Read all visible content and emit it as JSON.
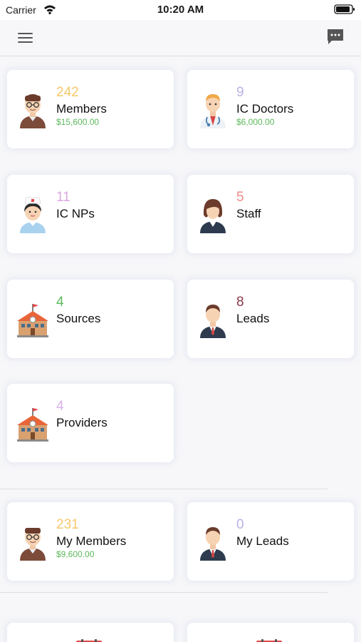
{
  "status_bar": {
    "carrier": "Carrier",
    "time": "10:20 AM"
  },
  "nav": {
    "menu_icon": "hamburger-menu-icon",
    "chat_icon": "chat-bubble-icon"
  },
  "cards": [
    {
      "icon": "doctor-male-icon",
      "count": "242",
      "title": "Members",
      "amount": "$15,600.00",
      "count_color": "#f5c96a"
    },
    {
      "icon": "doctor-stethoscope-icon",
      "count": "9",
      "title": "IC Doctors",
      "amount": "$6,000.00",
      "count_color": "#b9b2e6"
    },
    {
      "icon": "nurse-icon",
      "count": "11",
      "title": "IC NPs",
      "amount": "",
      "count_color": "#d9a8e0"
    },
    {
      "icon": "staff-woman-icon",
      "count": "5",
      "title": "Staff",
      "amount": "",
      "count_color": "#f08a8a"
    },
    {
      "icon": "school-building-icon",
      "count": "4",
      "title": "Sources",
      "amount": "",
      "count_color": "#5cb85c"
    },
    {
      "icon": "businessman-icon",
      "count": "8",
      "title": "Leads",
      "amount": "",
      "count_color": "#8b3a4a"
    },
    {
      "icon": "school-building-icon",
      "count": "4",
      "title": "Providers",
      "amount": "",
      "count_color": "#d9b3ea"
    },
    {
      "icon": "doctor-male-icon",
      "count": "231",
      "title": "My Members",
      "amount": "$9,600.00",
      "count_color": "#f5c96a"
    },
    {
      "icon": "businessman-icon",
      "count": "0",
      "title": "My Leads",
      "amount": "",
      "count_color": "#b9b2e6"
    }
  ],
  "calendar_icon": "calendar-icon"
}
